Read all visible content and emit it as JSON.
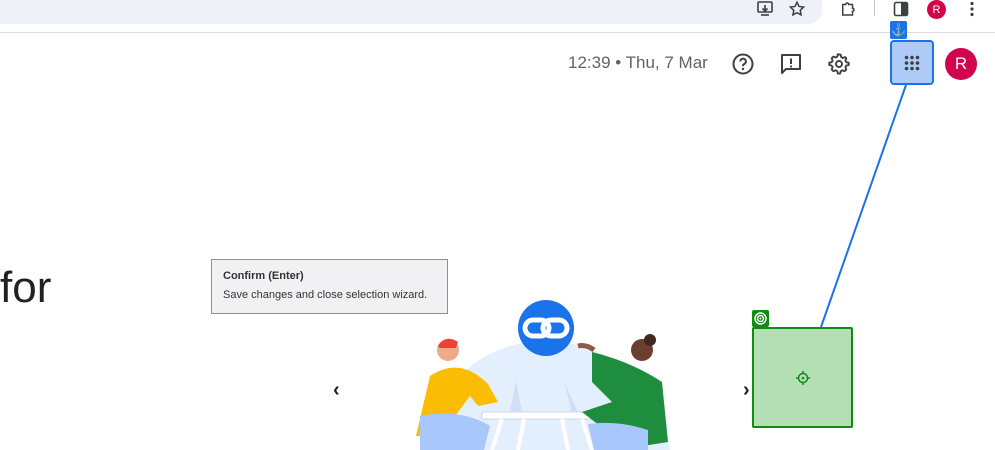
{
  "browser": {
    "avatar_letter": "R",
    "icons": [
      "install-app-icon",
      "star-icon",
      "extensions-icon",
      "side-panel-icon",
      "more-vert-icon"
    ]
  },
  "header": {
    "clock": "12:39 • Thu, 7 Mar",
    "icons": [
      "help-icon",
      "feedback-icon",
      "settings-icon",
      "apps-grid-icon"
    ],
    "avatar_letter": "R"
  },
  "main": {
    "partial_heading": "for"
  },
  "tooltip": {
    "title": "Confirm (Enter)",
    "description": "Save changes and close selection wizard."
  },
  "carousel": {
    "prev": "‹",
    "next": "›"
  },
  "colors": {
    "accent_blue": "#1a73e8",
    "avatar_red": "#d0034b",
    "target_green": "#138a13",
    "target_fill": "#b4dfb4",
    "anchor_fill": "#aecbf7"
  }
}
